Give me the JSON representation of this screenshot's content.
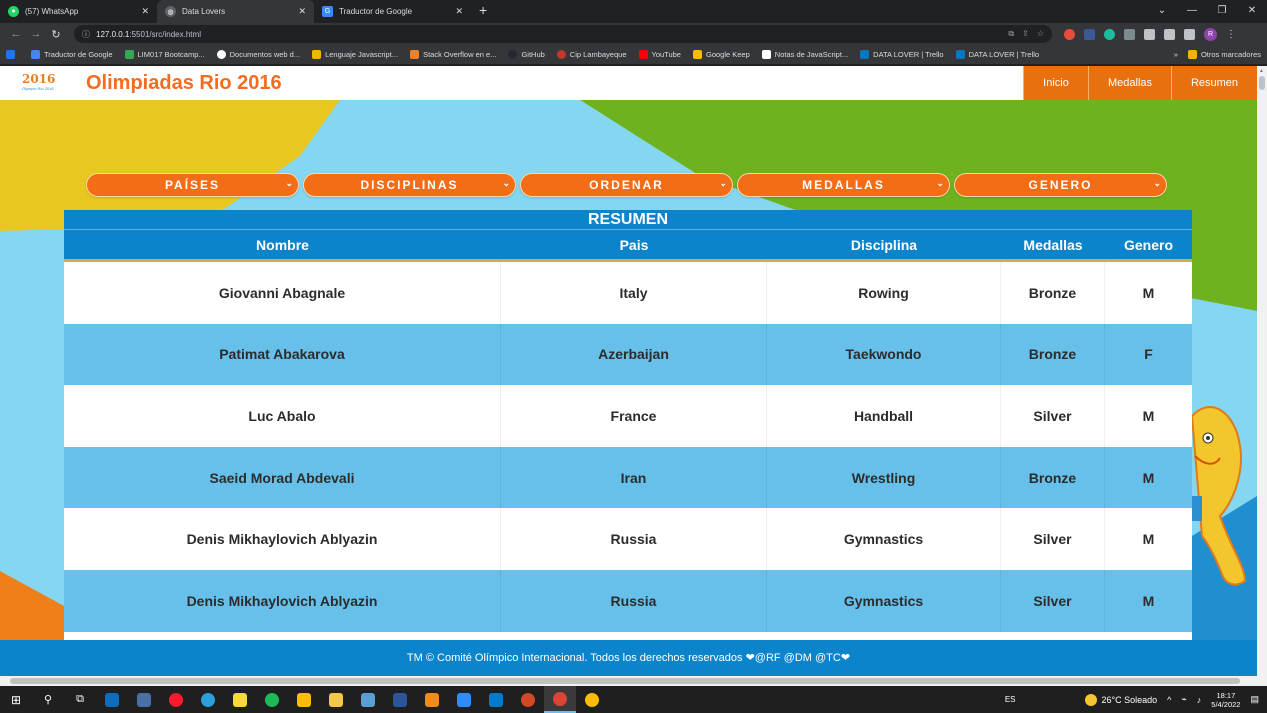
{
  "browser": {
    "tabs": [
      {
        "label": "(57) WhatsApp",
        "icon": "whatsapp-icon",
        "color": "#25d366",
        "active": false
      },
      {
        "label": "Data Lovers",
        "icon": "globe-icon",
        "color": "#9aa0a6",
        "active": true
      },
      {
        "label": "Traductor de Google",
        "icon": "google-translate-icon",
        "color": "#4285f4",
        "active": false
      }
    ],
    "url_host": "127.0.0.1",
    "url_rest": ":5501/src/index.html",
    "profile_initial": "R",
    "bookmarks": [
      {
        "label": "Traductor de Google",
        "color": "#4285f4"
      },
      {
        "label": "LIM017 Bootcamp...",
        "color": "#34a853"
      },
      {
        "label": "Documentos web d...",
        "color": "#ffffff"
      },
      {
        "label": "Lenguaje Javascript...",
        "color": "#f4b400"
      },
      {
        "label": "Stack Overflow en e...",
        "color": "#f48024"
      },
      {
        "label": "GitHub",
        "color": "#24292e"
      },
      {
        "label": "Cip Lambayeque",
        "color": "#c0392b"
      },
      {
        "label": "YouTube",
        "color": "#ff0000"
      },
      {
        "label": "Google Keep",
        "color": "#fbbc04"
      },
      {
        "label": "Notas de JavaScript...",
        "color": "#ffffff"
      },
      {
        "label": "DATA LOVER | Trello",
        "color": "#0079bf"
      },
      {
        "label": "DATA LOVER | Trello",
        "color": "#0079bf"
      }
    ],
    "bookmarks_more": "»",
    "other_bookmarks": "Otros marcadores"
  },
  "site": {
    "logo_text": "2016",
    "logo_sub": "Olympic Rio 2016",
    "title": "Olimpiadas Rio 2016",
    "nav": [
      {
        "label": "Inicio"
      },
      {
        "label": "Medallas"
      },
      {
        "label": "Resumen"
      }
    ]
  },
  "filters": [
    {
      "label": "PAÍSES"
    },
    {
      "label": "DISCIPLINAS"
    },
    {
      "label": "ORDENAR"
    },
    {
      "label": "MEDALLAS"
    },
    {
      "label": "GENERO"
    }
  ],
  "table": {
    "caption": "RESUMEN",
    "headers": [
      "Nombre",
      "Pais",
      "Disciplina",
      "Medallas",
      "Genero"
    ],
    "rows": [
      [
        "Giovanni Abagnale",
        "Italy",
        "Rowing",
        "Bronze",
        "M"
      ],
      [
        "Patimat Abakarova",
        "Azerbaijan",
        "Taekwondo",
        "Bronze",
        "F"
      ],
      [
        "Luc Abalo",
        "France",
        "Handball",
        "Silver",
        "M"
      ],
      [
        "Saeid Morad Abdevali",
        "Iran",
        "Wrestling",
        "Bronze",
        "M"
      ],
      [
        "Denis Mikhaylovich Ablyazin",
        "Russia",
        "Gymnastics",
        "Silver",
        "M"
      ],
      [
        "Denis Mikhaylovich Ablyazin",
        "Russia",
        "Gymnastics",
        "Silver",
        "M"
      ]
    ]
  },
  "footer": {
    "text": "TM © Comité Olímpico Internacional. Todos los derechos reservados ❤@RF @DM @TC❤"
  },
  "taskbar": {
    "lang": "ES",
    "weather": "26°C  Soleado",
    "time": "18:17",
    "date": "5/4/2022"
  }
}
